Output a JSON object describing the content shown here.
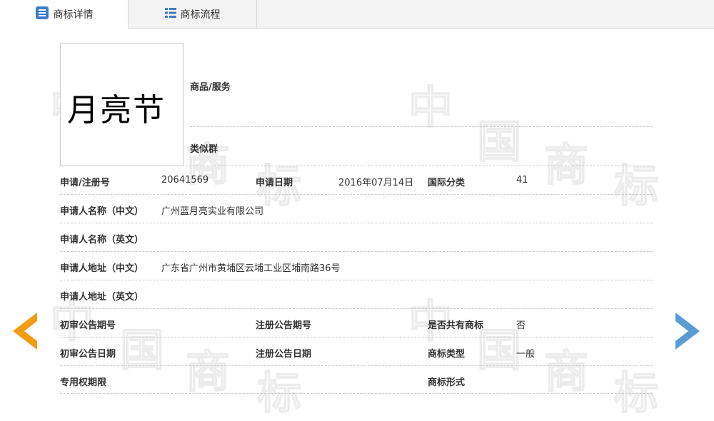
{
  "tabs": [
    {
      "label": "商标详情",
      "active": true,
      "icon": "document-icon"
    },
    {
      "label": "商标流程",
      "active": false,
      "icon": "list-icon"
    }
  ],
  "trademark": {
    "logo_text": "月亮节",
    "goods_services_label": "商品/服务",
    "similar_group_label": "类似群",
    "reg_no_label": "申请/注册号",
    "reg_no": "20641569",
    "app_date_label": "申请日期",
    "app_date": "2016年07月14日",
    "intl_class_label": "国际分类",
    "intl_class": "41",
    "applicant_cn_label": "申请人名称（中文）",
    "applicant_cn": "广州蓝月亮实业有限公司",
    "applicant_en_label": "申请人名称（英文）",
    "address_cn_label": "申请人地址（中文）",
    "address_cn": "广东省广州市黄埔区云埔工业区埔南路36号",
    "address_en_label": "申请人地址（英文）",
    "prelim_pub_no_label": "初审公告期号",
    "reg_pub_no_label": "注册公告期号",
    "shared_label": "是否共有商标",
    "shared": "否",
    "prelim_pub_date_label": "初审公告日期",
    "reg_pub_date_label": "注册公告日期",
    "tm_type_label": "商标类型",
    "tm_type": "一般",
    "exclusive_period_label": "专用权期限",
    "tm_form_label": "商标形式"
  },
  "colors": {
    "prev_arrow": "#f39c12",
    "next_arrow": "#5b9bd5",
    "tab_icon": "#3d7cc9"
  }
}
